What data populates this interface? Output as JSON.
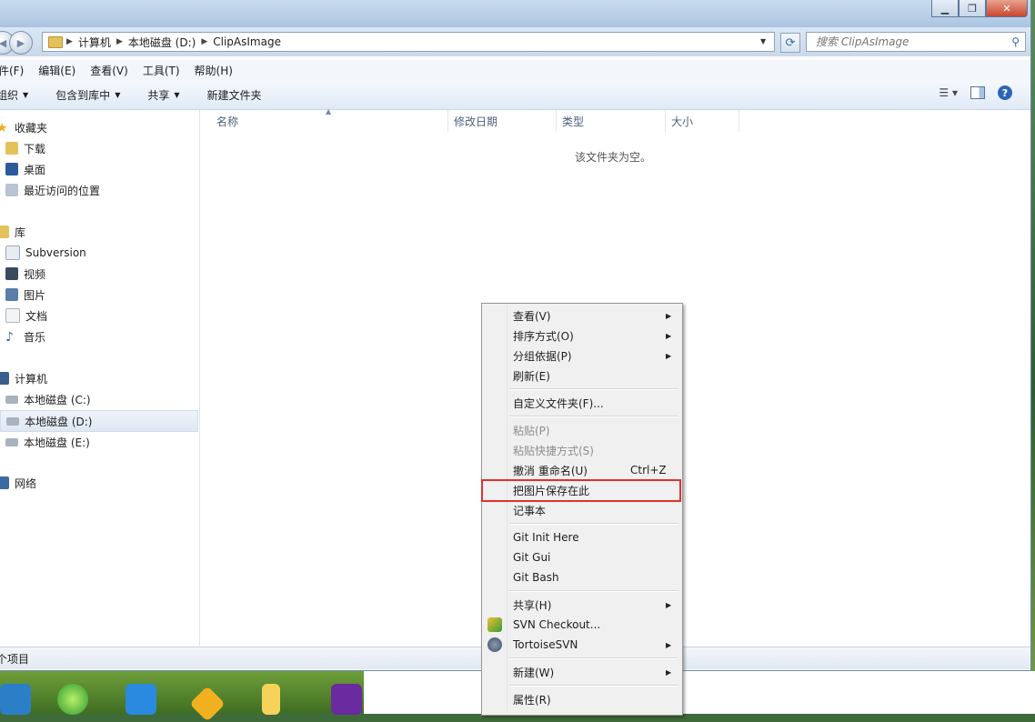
{
  "window": {
    "address_segments": [
      "计算机",
      "本地磁盘 (D:)",
      "ClipAsImage"
    ],
    "search_placeholder": "搜索 ClipAsImage"
  },
  "menubar": [
    "件(F)",
    "编辑(E)",
    "查看(V)",
    "工具(T)",
    "帮助(H)"
  ],
  "toolbar": {
    "organize": "组织",
    "include": "包含到库中",
    "share": "共享",
    "new_folder": "新建文件夹"
  },
  "nav": {
    "favorites": "收藏夹",
    "fav_items": [
      "下载",
      "桌面",
      "最近访问的位置"
    ],
    "libraries": "库",
    "lib_items": [
      "Subversion",
      "视频",
      "图片",
      "文档",
      "音乐"
    ],
    "computer": "计算机",
    "drives": [
      "本地磁盘 (C:)",
      "本地磁盘 (D:)",
      "本地磁盘 (E:)"
    ],
    "network": "网络"
  },
  "columns": [
    "名称",
    "修改日期",
    "类型",
    "大小"
  ],
  "empty_message": "该文件夹为空。",
  "status": "个项目",
  "context_menu": {
    "items": [
      {
        "label": "查看(V)"
      },
      {
        "label": "排序方式(O)"
      },
      {
        "label": "分组依据(P)"
      },
      {
        "label": "刷新(E)"
      },
      {
        "label": "自定义文件夹(F)..."
      },
      {
        "label": "粘贴(P)"
      },
      {
        "label": "粘贴快捷方式(S)"
      },
      {
        "label": "撤消 重命名(U)",
        "shortcut": "Ctrl+Z"
      },
      {
        "label": "把图片保存在此"
      },
      {
        "label": "记事本"
      },
      {
        "label": "Git Init Here"
      },
      {
        "label": "Git Gui"
      },
      {
        "label": "Git Bash"
      },
      {
        "label": "共享(H)"
      },
      {
        "label": "SVN Checkout..."
      },
      {
        "label": "TortoiseSVN"
      },
      {
        "label": "新建(W)"
      },
      {
        "label": "属性(R)"
      }
    ]
  },
  "colors": {
    "highlight_border": "#e0312b",
    "title_bar": "#b7cfe6"
  }
}
